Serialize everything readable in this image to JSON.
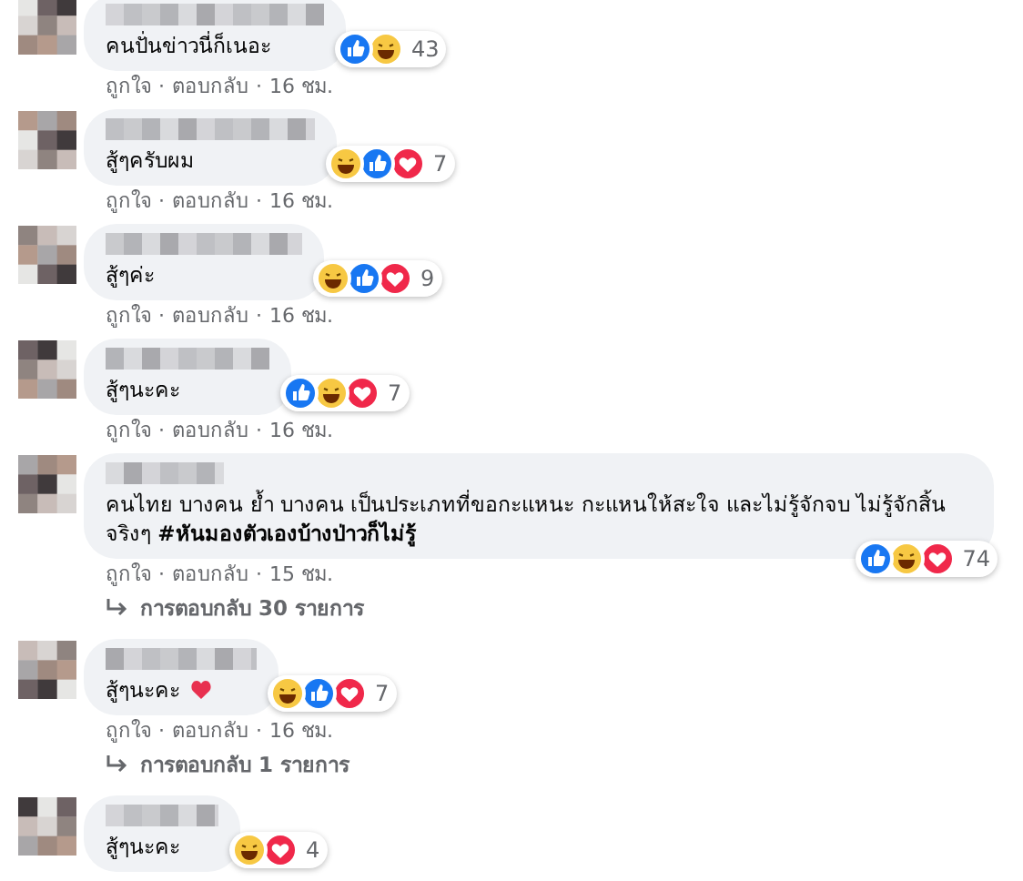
{
  "comments": [
    {
      "text": "คนปั่นข่าวนี่ก็เนอะ",
      "reactions": [
        {
          "kind": "like"
        },
        {
          "kind": "haha"
        }
      ],
      "reaction_count": "43",
      "actions": [
        "ถูกใจ",
        "ตอบกลับ"
      ],
      "separator": "·",
      "time": "16 ชม."
    },
    {
      "text": "สู้ๆครับผม",
      "reactions": [
        {
          "kind": "haha"
        },
        {
          "kind": "like"
        },
        {
          "kind": "love"
        }
      ],
      "reaction_count": "7",
      "actions": [
        "ถูกใจ",
        "ตอบกลับ"
      ],
      "separator": "·",
      "time": "16 ชม."
    },
    {
      "text": "สู้ๆค่ะ",
      "reactions": [
        {
          "kind": "haha"
        },
        {
          "kind": "like"
        },
        {
          "kind": "love"
        }
      ],
      "reaction_count": "9",
      "actions": [
        "ถูกใจ",
        "ตอบกลับ"
      ],
      "separator": "·",
      "time": "16 ชม."
    },
    {
      "text": "สู้ๆนะคะ",
      "reactions": [
        {
          "kind": "like"
        },
        {
          "kind": "haha"
        },
        {
          "kind": "love"
        }
      ],
      "reaction_count": "7",
      "actions": [
        "ถูกใจ",
        "ตอบกลับ"
      ],
      "separator": "·",
      "time": "16 ชม."
    },
    {
      "text": "คนไทย บางคน ย้ำ บางคน เป็นประเภทที่ขอกะแหนะ กะแหนให้สะใจ และไม่รู้จักจบ ไม่รู้จักสิ้น จริงๆ **#หันมองตัวเองบ้างป่าวก็ไม่รู้**",
      "reactions": [
        {
          "kind": "like"
        },
        {
          "kind": "haha"
        },
        {
          "kind": "love"
        }
      ],
      "reaction_count": "74",
      "actions": [
        "ถูกใจ",
        "ตอบกลับ"
      ],
      "separator": "·",
      "time": "15 ชม.",
      "replies_link": "การตอบกลับ 30 รายการ"
    },
    {
      "text": "สู้ๆนะคะ",
      "heart_emoji": true,
      "reactions": [
        {
          "kind": "haha"
        },
        {
          "kind": "like"
        },
        {
          "kind": "love"
        }
      ],
      "reaction_count": "7",
      "actions": [
        "ถูกใจ",
        "ตอบกลับ"
      ],
      "separator": "·",
      "time": "16 ชม.",
      "replies_link": "การตอบกลับ 1 รายการ"
    },
    {
      "text": "สู้ๆนะคะ",
      "reactions": [
        {
          "kind": "haha"
        },
        {
          "kind": "love"
        }
      ],
      "reaction_count": "4"
    }
  ]
}
